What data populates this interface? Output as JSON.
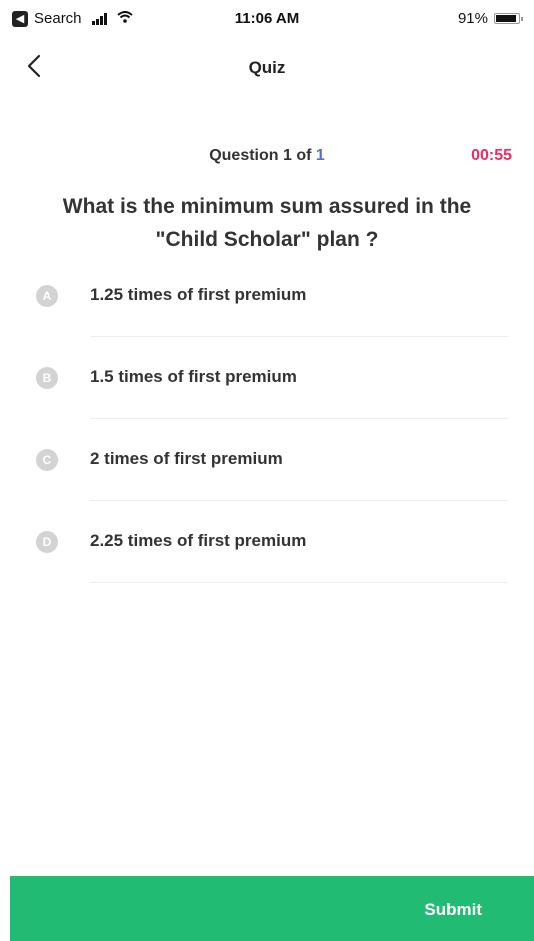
{
  "status_bar": {
    "back_app_label": "Search",
    "time": "11:06 AM",
    "battery": "91%",
    "icons": [
      "signal-icon",
      "wifi-icon",
      "battery-icon"
    ]
  },
  "nav": {
    "title": "Quiz",
    "back_icon": "chevron-left-icon"
  },
  "question": {
    "count_prefix": "Question 1 of ",
    "count_total": "1",
    "timer": "00:55",
    "text": "What is the minimum sum assured in the \"Child Scholar\" plan ?"
  },
  "options": [
    {
      "letter": "A",
      "text": "1.25 times of first premium"
    },
    {
      "letter": "B",
      "text": "1.5 times of first premium"
    },
    {
      "letter": "C",
      "text": "2 times of first premium"
    },
    {
      "letter": "D",
      "text": "2.25 times of first premium"
    }
  ],
  "submit": {
    "label": "Submit"
  },
  "colors": {
    "accent_green": "#22bb74",
    "timer_red": "#ee2b63",
    "count_blue": "#5b6bd6"
  }
}
